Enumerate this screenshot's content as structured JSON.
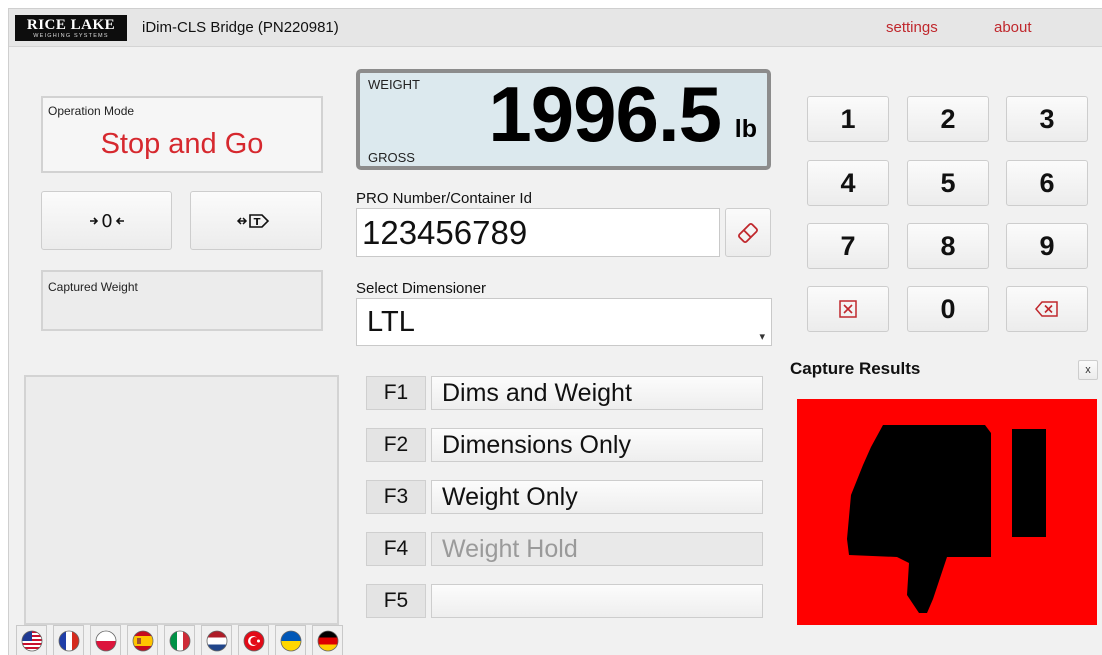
{
  "app": {
    "logo_main": "RICE LAKE",
    "logo_sub": "WEIGHING SYSTEMS",
    "title": "iDim-CLS Bridge (PN220981)",
    "nav": {
      "settings": "settings",
      "about": "about"
    }
  },
  "operation_mode": {
    "label": "Operation Mode",
    "value": "Stop and Go"
  },
  "scale_buttons": {
    "zero_icon": "zero-icon",
    "tare_icon": "tare-icon"
  },
  "captured_weight": {
    "label": "Captured Weight",
    "value": ""
  },
  "weight_display": {
    "top_label": "WEIGHT",
    "bottom_label": "GROSS",
    "value": "1996.5",
    "unit": "lb"
  },
  "pro_number": {
    "label": "PRO Number/Container Id",
    "value": "123456789",
    "clear_icon": "eraser-icon"
  },
  "dimensioner": {
    "label": "Select Dimensioner",
    "selected": "LTL",
    "caret_icon": "caret-down-icon"
  },
  "function_keys": [
    {
      "key": "F1",
      "label": "Dims and Weight",
      "enabled": true
    },
    {
      "key": "F2",
      "label": "Dimensions Only",
      "enabled": true
    },
    {
      "key": "F3",
      "label": "Weight Only",
      "enabled": true
    },
    {
      "key": "F4",
      "label": "Weight Hold",
      "enabled": false
    },
    {
      "key": "F5",
      "label": "",
      "enabled": true
    }
  ],
  "keypad": {
    "keys": [
      "1",
      "2",
      "3",
      "4",
      "5",
      "6",
      "7",
      "8",
      "9",
      "",
      "0",
      ""
    ],
    "clear_icon": "clear-x-icon",
    "backspace_icon": "backspace-icon"
  },
  "capture_results": {
    "title": "Capture Results",
    "close": "x",
    "result_icon": "thumbs-down-icon",
    "color": "#ff0000"
  },
  "languages": [
    "us-flag",
    "france-flag",
    "poland-flag",
    "spain-flag",
    "italy-flag",
    "netherlands-flag",
    "turkey-flag",
    "ukraine-flag",
    "germany-flag"
  ],
  "colors": {
    "accent_red": "#d6282e",
    "link_red": "#c0282d",
    "display_bg": "#dce9ee"
  }
}
